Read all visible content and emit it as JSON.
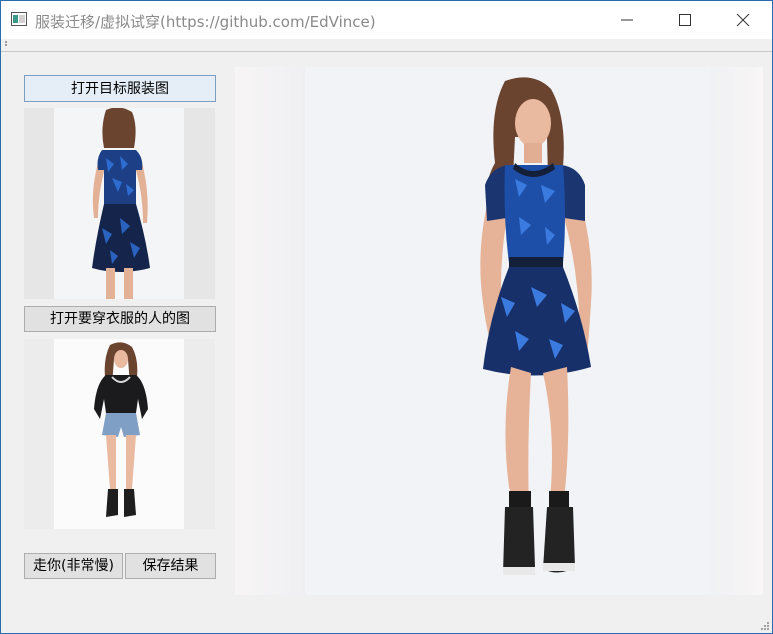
{
  "window": {
    "title": "服装迁移/虚拟试穿(https://github.com/EdVince)"
  },
  "buttons": {
    "open_target": "打开目标服装图",
    "open_person": "打开要穿衣服的人的图",
    "run": "走你(非常慢)",
    "save": "保存结果"
  },
  "colors": {
    "dress_blue": "#1e4fa8",
    "dress_dark": "#14203a",
    "skin": "#e9b9a0",
    "hair": "#6b4430",
    "denim": "#7f9fc4",
    "black_top": "#1b1b1e"
  }
}
